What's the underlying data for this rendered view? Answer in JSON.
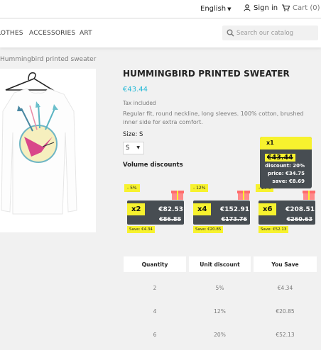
{
  "topbar": {
    "language": "English",
    "signin_label": "Sign in",
    "cart_label": "Cart (0)"
  },
  "nav": {
    "items": [
      "LOTHES",
      "ACCESSORIES",
      "ART"
    ]
  },
  "search": {
    "placeholder": "Search our catalog"
  },
  "breadcrumb": "Hummingbird printed sweater",
  "product": {
    "title": "HUMMINGBIRD PRINTED SWEATER",
    "price": "€43.44",
    "tax_label": "Tax included",
    "description": "Regular fit, round neckline, long sleeves. 100% cotton, brushed inner side for extra comfort.",
    "size_label": "Size: S",
    "size_value": "S"
  },
  "volume_discounts": {
    "title": "Volume discounts",
    "tooltip": {
      "header": "x1",
      "old_price": "€43.44",
      "discount": "discount: 20%",
      "price": "price: €34.75",
      "save": "save: €8.69"
    },
    "cards": [
      {
        "percent": "- 5%",
        "multiplier": "x2",
        "new_price": "€82.53",
        "old_price": "€86.88",
        "save": "Save: €4.34"
      },
      {
        "percent": "- 12%",
        "multiplier": "x4",
        "new_price": "€152.91",
        "old_price": "€173.76",
        "save": "Save: €20.85"
      },
      {
        "percent": "- 20%",
        "multiplier": "x6",
        "new_price": "€208.51",
        "old_price": "€260.63",
        "save": "Save: €52.13"
      }
    ],
    "table": {
      "headers": [
        "Quantity",
        "Unit discount",
        "You Save"
      ],
      "rows": [
        [
          "2",
          "5%",
          "€4.34"
        ],
        [
          "4",
          "12%",
          "€20.85"
        ],
        [
          "6",
          "20%",
          "€52.13"
        ]
      ]
    }
  },
  "colors": {
    "accent": "#24b9d7",
    "highlight": "#f7f22e",
    "dark": "#474d52"
  }
}
